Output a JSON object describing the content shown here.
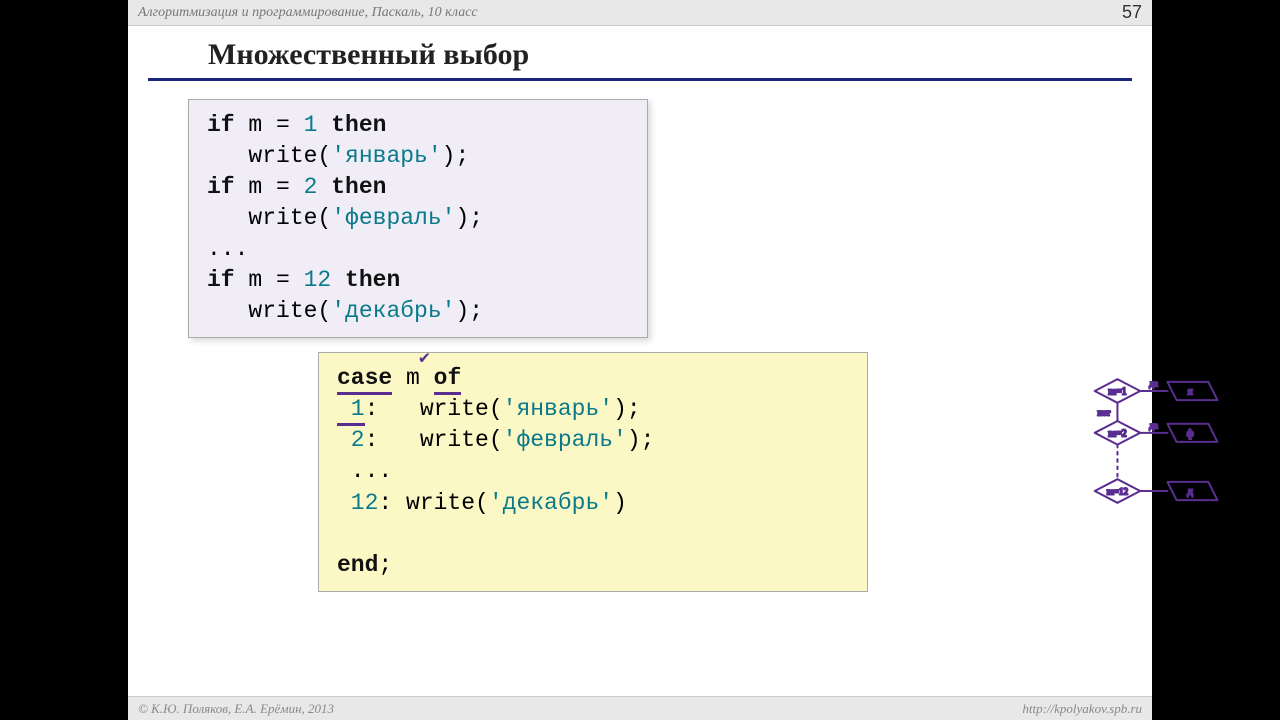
{
  "header": {
    "course": "Алгоритмизация и программирование, Паскаль, 10 класс",
    "page": "57"
  },
  "title": "Множественный выбор",
  "code_if": {
    "l1a": "if",
    "l1b": " m = ",
    "l1c": "1",
    "l1d": " then",
    "l2a": "   write(",
    "l2b": "'январь'",
    "l2c": ");",
    "l3a": "if",
    "l3b": " m = ",
    "l3c": "2",
    "l3d": " then",
    "l4a": "   write(",
    "l4b": "'февраль'",
    "l4c": ");",
    "l5": "...",
    "l6a": "if",
    "l6b": " m = ",
    "l6c": "12",
    "l6d": " then",
    "l7a": "   write(",
    "l7b": "'декабрь'",
    "l7c": ");"
  },
  "code_case": {
    "l1a": "case",
    "l1b": " m ",
    "l1c": "of",
    "l2a": " 1",
    "l2b": ":   write(",
    "l2c": "'январь'",
    "l2d": ");",
    "l3a": " 2",
    "l3b": ":   write(",
    "l3c": "'февраль'",
    "l3d": ");",
    "l4": " ...",
    "l5a": " 12",
    "l5b": ": write(",
    "l5c": "'декабрь'",
    "l5d": ")",
    "l6": " ",
    "l7": "end",
    "l7b": ";"
  },
  "footer": {
    "authors": "© К.Ю. Поляков, Е.А. Ерёмин, 2013",
    "url": "http://kpolyakov.spb.ru"
  }
}
